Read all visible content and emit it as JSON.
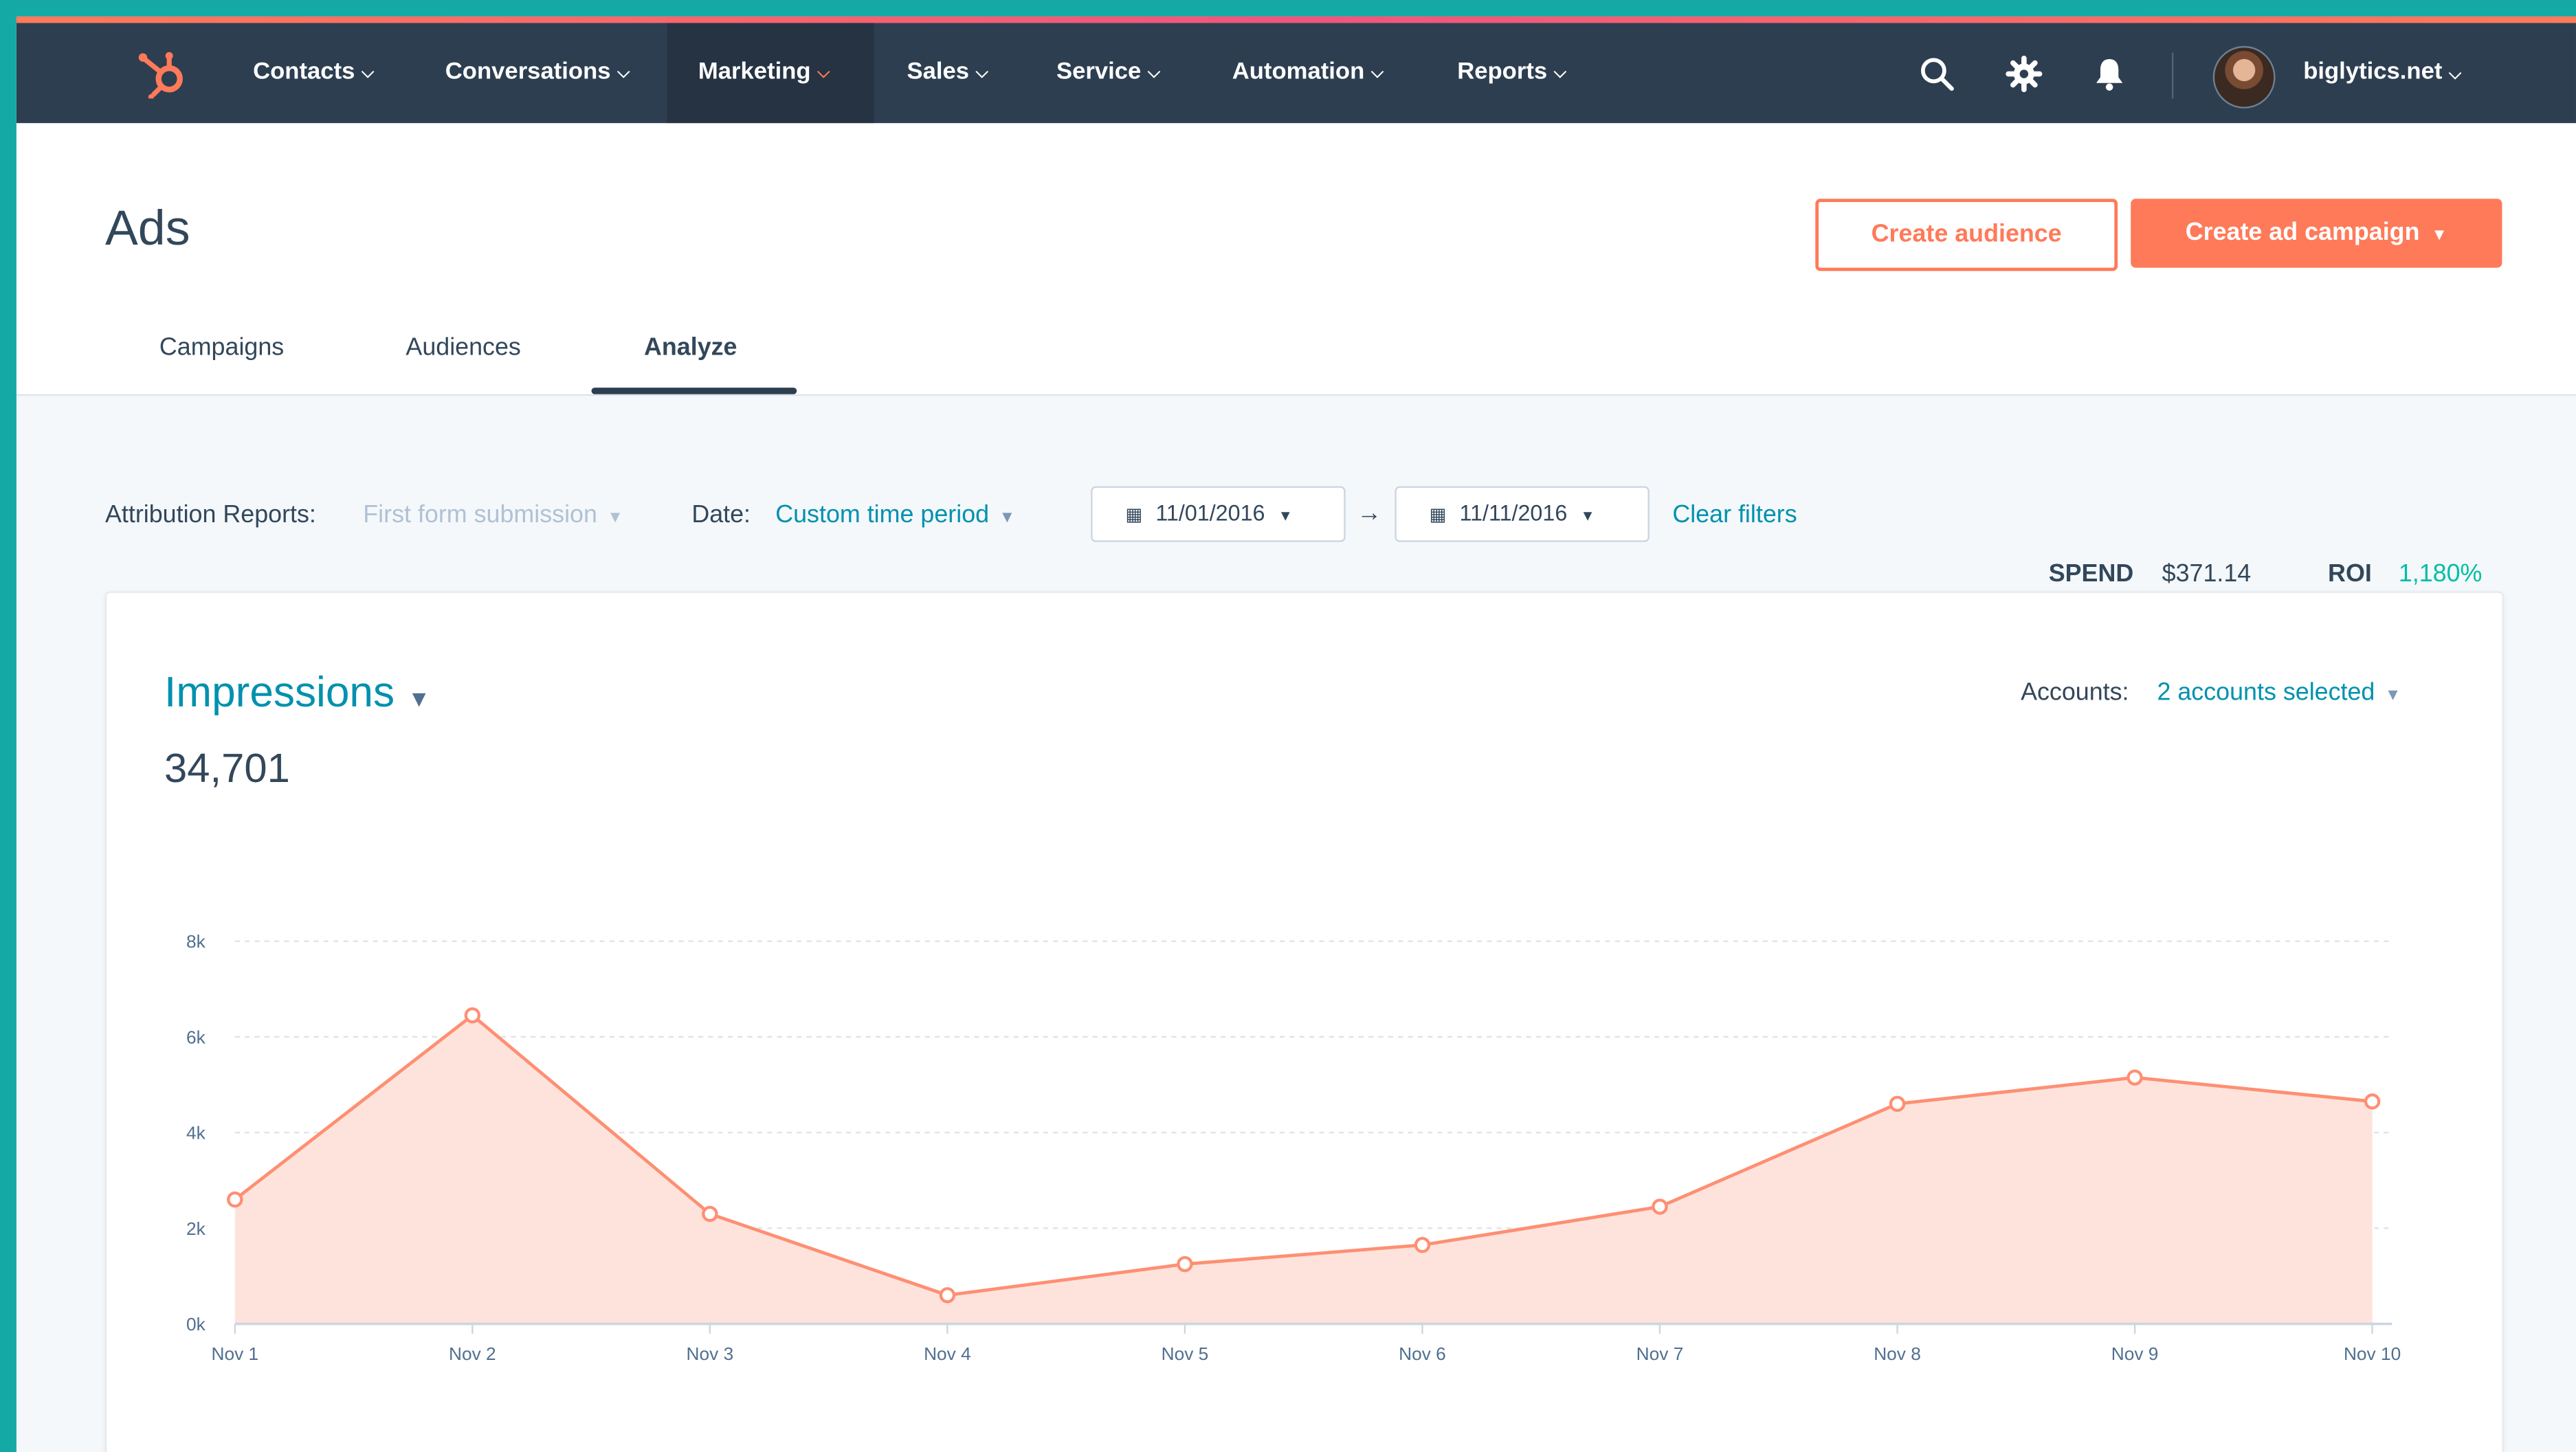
{
  "nav": {
    "items": [
      {
        "label": "Contacts",
        "active": false
      },
      {
        "label": "Conversations",
        "active": false
      },
      {
        "label": "Marketing",
        "active": true
      },
      {
        "label": "Sales",
        "active": false
      },
      {
        "label": "Service",
        "active": false
      },
      {
        "label": "Automation",
        "active": false
      },
      {
        "label": "Reports",
        "active": false
      }
    ],
    "account": "biglytics.net",
    "icons": [
      "hubspot-logo-icon",
      "search-icon",
      "gear-icon",
      "bell-icon"
    ]
  },
  "page": {
    "title": "Ads",
    "create_audience": "Create audience",
    "create_campaign": "Create ad campaign"
  },
  "tabs": [
    {
      "label": "Campaigns",
      "active": false
    },
    {
      "label": "Audiences",
      "active": false
    },
    {
      "label": "Analyze",
      "active": true
    }
  ],
  "filters": {
    "attribution_label": "Attribution Reports:",
    "attribution_value": "First form submission",
    "date_label": "Date:",
    "date_value": "Custom time period",
    "start_date": "11/01/2016",
    "end_date": "11/11/2016",
    "clear": "Clear filters"
  },
  "stats": {
    "spend_label": "SPEND",
    "spend_value": "$371.14",
    "roi_label": "ROI",
    "roi_value": "1,180%"
  },
  "card": {
    "metric": "Impressions",
    "total": "34,701",
    "accounts_label": "Accounts:",
    "accounts_value": "2 accounts selected"
  },
  "colors": {
    "nav_bg": "#2d3e50",
    "accent": "#ff7a59",
    "link": "#0091ae",
    "roi": "#00bda5"
  },
  "chart_data": {
    "type": "area",
    "x": [
      "Nov 1",
      "Nov 2",
      "Nov 3",
      "Nov 4",
      "Nov 5",
      "Nov 6",
      "Nov 7",
      "Nov 8",
      "Nov 9",
      "Nov 10"
    ],
    "values": [
      2600,
      6450,
      2300,
      600,
      1250,
      1650,
      2450,
      4600,
      5150,
      4650
    ],
    "yticks": [
      0,
      2000,
      4000,
      6000,
      8000
    ],
    "ytick_labels": [
      "0k",
      "2k",
      "4k",
      "6k",
      "8k"
    ],
    "ylim": [
      0,
      8000
    ],
    "grid": true
  }
}
